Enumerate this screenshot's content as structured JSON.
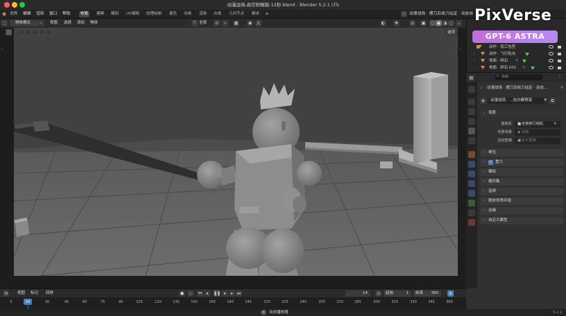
{
  "window": {
    "title": "动漫战场-高空俯瞰版-12秒.blend - Blender 5.2.1 LTS",
    "traffic_lights": [
      "#ff5f57",
      "#febc2e",
      "#28c840"
    ]
  },
  "menu": {
    "items": [
      "文件",
      "编辑",
      "渲染",
      "窗口",
      "帮助"
    ],
    "workspaces": [
      "布局",
      "建模",
      "雕刻",
      "UV编辑",
      "纹理绘制",
      "着色",
      "动画",
      "渲染",
      "合成",
      "几何节点",
      "脚本"
    ],
    "active_workspace": "布局",
    "add_tab": "+",
    "scene_name": "动漫战场 · 摆刀后收刀站定 · 动态",
    "scene_name_visible": "动漫战场 · 摆刀后收刀站定 · 动态台"
  },
  "viewport_header": {
    "mode": "物体模式",
    "menus": [
      "视图",
      "选择",
      "添加",
      "物体"
    ],
    "transform_orientation": "全局",
    "select_button": "选项"
  },
  "outliner": {
    "rows": [
      {
        "name": "动作 · 加工包型"
      },
      {
        "name": "动作 · 飞行轨击"
      },
      {
        "name": "地面 · 碎石"
      },
      {
        "name": "地面 · 碎石.001"
      }
    ]
  },
  "properties": {
    "search_placeholder": "搜索",
    "scene_path": "动漫战场 · 摆刀后收刀站定 · 动态...",
    "scene_field": "动漫战场 · ...态白模预演",
    "scene_panel": "场景",
    "camera_label": "摄像机",
    "camera_value": "定格穿行相机",
    "background_label": "背景场景",
    "background_placeholder": "场景",
    "clip_label": "活动剪辑",
    "clip_placeholder": "影片剪辑",
    "panels": [
      "单位",
      "重力",
      "模拟",
      "缓存集",
      "音频",
      "刚体世界环境",
      "动画",
      "自定义属性"
    ],
    "gravity_checked": true
  },
  "timeline": {
    "menus": [
      "视图",
      "标记",
      "回放"
    ],
    "current_frame": "14",
    "start_label": "起始",
    "start_value": "1",
    "end_label": "结束",
    "end_value": "360",
    "ticks": [
      "0",
      "14",
      "30",
      "45",
      "60",
      "75",
      "90",
      "105",
      "120",
      "135",
      "150",
      "165",
      "180",
      "195",
      "210",
      "225",
      "240",
      "255",
      "270",
      "285",
      "300",
      "315",
      "330",
      "345",
      "360"
    ]
  },
  "status": {
    "hint": "动态播放器",
    "version": "5.2.1"
  },
  "watermark": {
    "brand": "PixVerse",
    "model": "GPT-6 ASTRA"
  }
}
